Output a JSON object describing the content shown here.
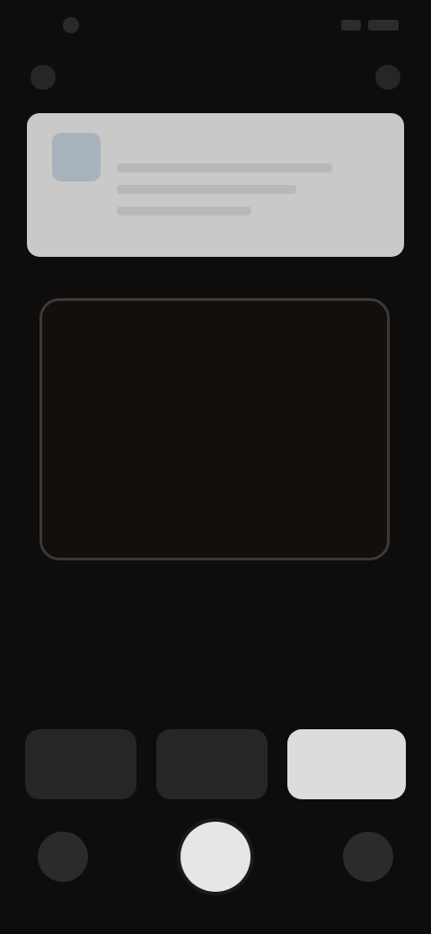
{
  "status_bar": {
    "time": "",
    "icons": [
      "notification-icon",
      "signal-icon",
      "battery-icon"
    ]
  },
  "toolbar": {
    "left_icon": "back-icon",
    "right_icon": "more-icon"
  },
  "hint_card": {
    "icon": "info-icon",
    "title": "",
    "body": ""
  },
  "viewfinder": {
    "frame": "scan-frame"
  },
  "modes": [
    {
      "label": "",
      "icon": "mode-1-icon",
      "active": false
    },
    {
      "label": "",
      "icon": "mode-2-icon",
      "active": false
    },
    {
      "label": "",
      "icon": "mode-3-icon",
      "active": true
    }
  ],
  "bottom_controls": {
    "left_icon": "gallery-icon",
    "shutter_icon": "shutter-icon",
    "right_icon": "switch-camera-icon"
  },
  "colors": {
    "background": "#0e0d0c",
    "card": "#c9c9c7",
    "frame": "#3b3a38",
    "active_mode": "#dcdcdc"
  }
}
